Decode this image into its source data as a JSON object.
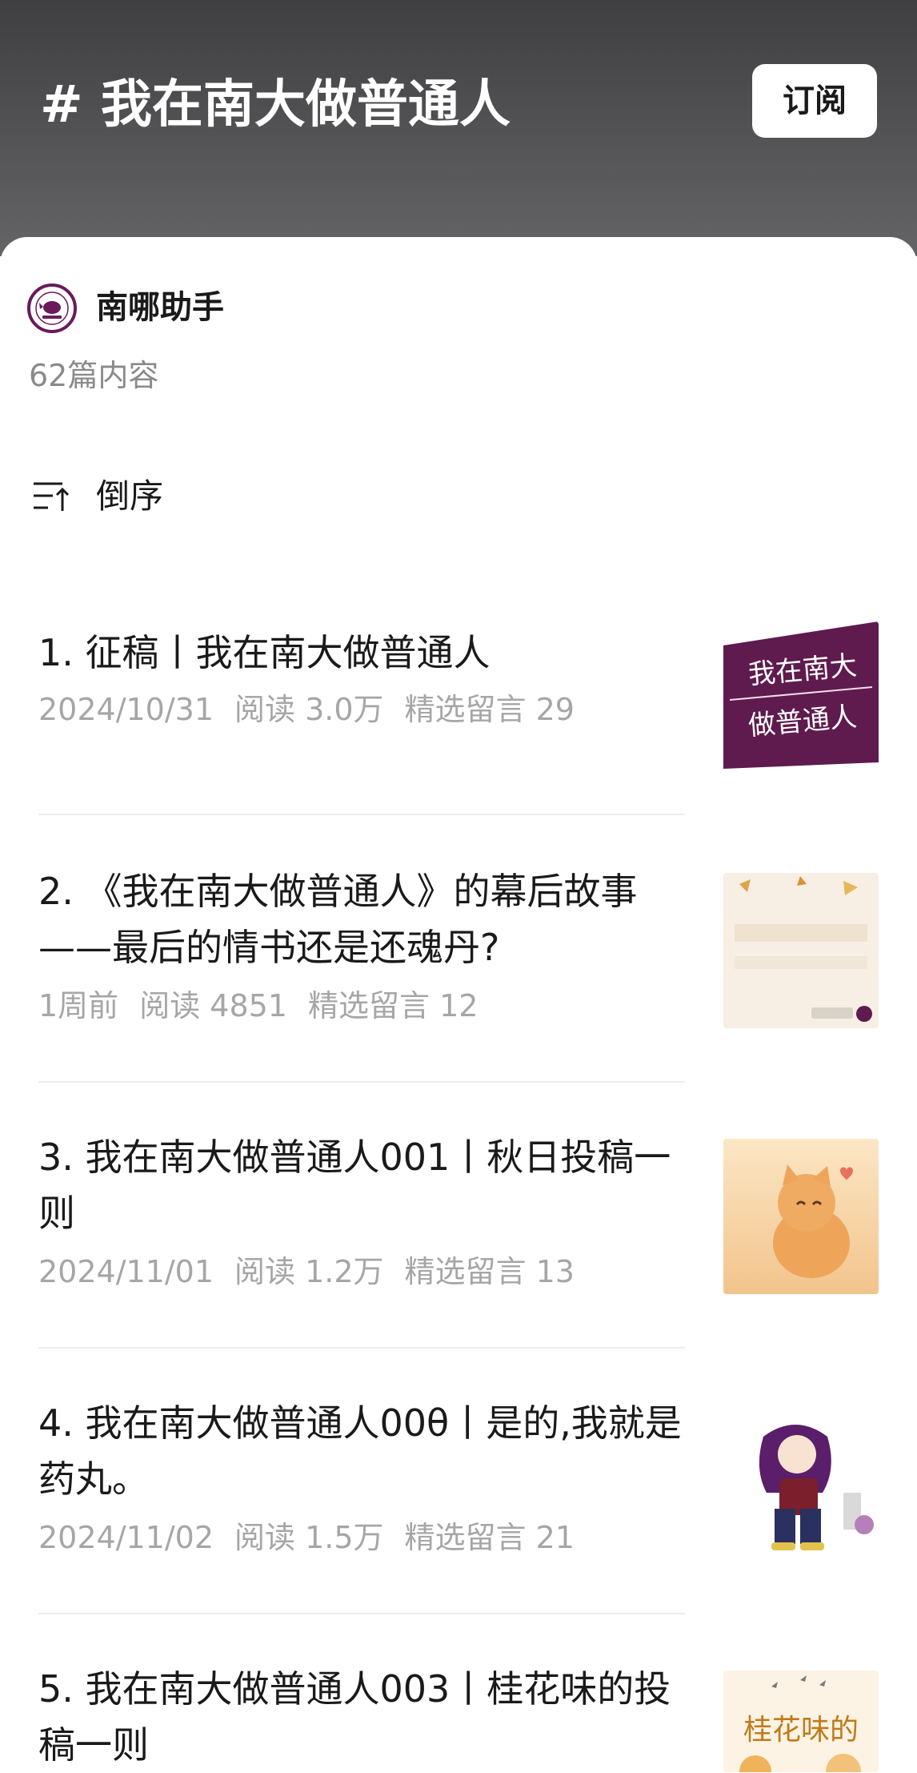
{
  "header": {
    "topic_title": "# 我在南大做普通人",
    "subscribe_label": "订阅",
    "background_color": "#545456"
  },
  "account": {
    "name": "南哪助手",
    "content_count": "62篇内容",
    "avatar_icon": "account-avatar-logo",
    "brand_color": "#6a1a5c"
  },
  "sort": {
    "icon": "sort-icon",
    "label": "倒序"
  },
  "articles": [
    {
      "title": "1. 征稿丨我在南大做普通人",
      "date": "2024/10/31",
      "reads": "阅读 3.0万",
      "comments": "精选留言 29",
      "thumbnail": "purple-banner-thumbnail"
    },
    {
      "title": "2. 《我在南大做普通人》的幕后故事——最后的情书还是还魂丹?",
      "date": "1周前",
      "reads": "阅读 4851",
      "comments": "精选留言 12",
      "thumbnail": "dialogue-card-thumbnail"
    },
    {
      "title": "3. 我在南大做普通人001丨秋日投稿一则",
      "date": "2024/11/01",
      "reads": "阅读 1.2万",
      "comments": "精选留言 13",
      "thumbnail": "orange-cat-thumbnail"
    },
    {
      "title": "4. 我在南大做普通人00θ丨是的,我就是药丸。",
      "date": "2024/11/02",
      "reads": "阅读 1.5万",
      "comments": "精选留言 21",
      "thumbnail": "anime-character-thumbnail"
    },
    {
      "title": "5. 我在南大做普通人003丨桂花味的投稿一则",
      "date": "",
      "reads": "",
      "comments": "",
      "thumbnail": "osmanthus-thumbnail"
    }
  ]
}
